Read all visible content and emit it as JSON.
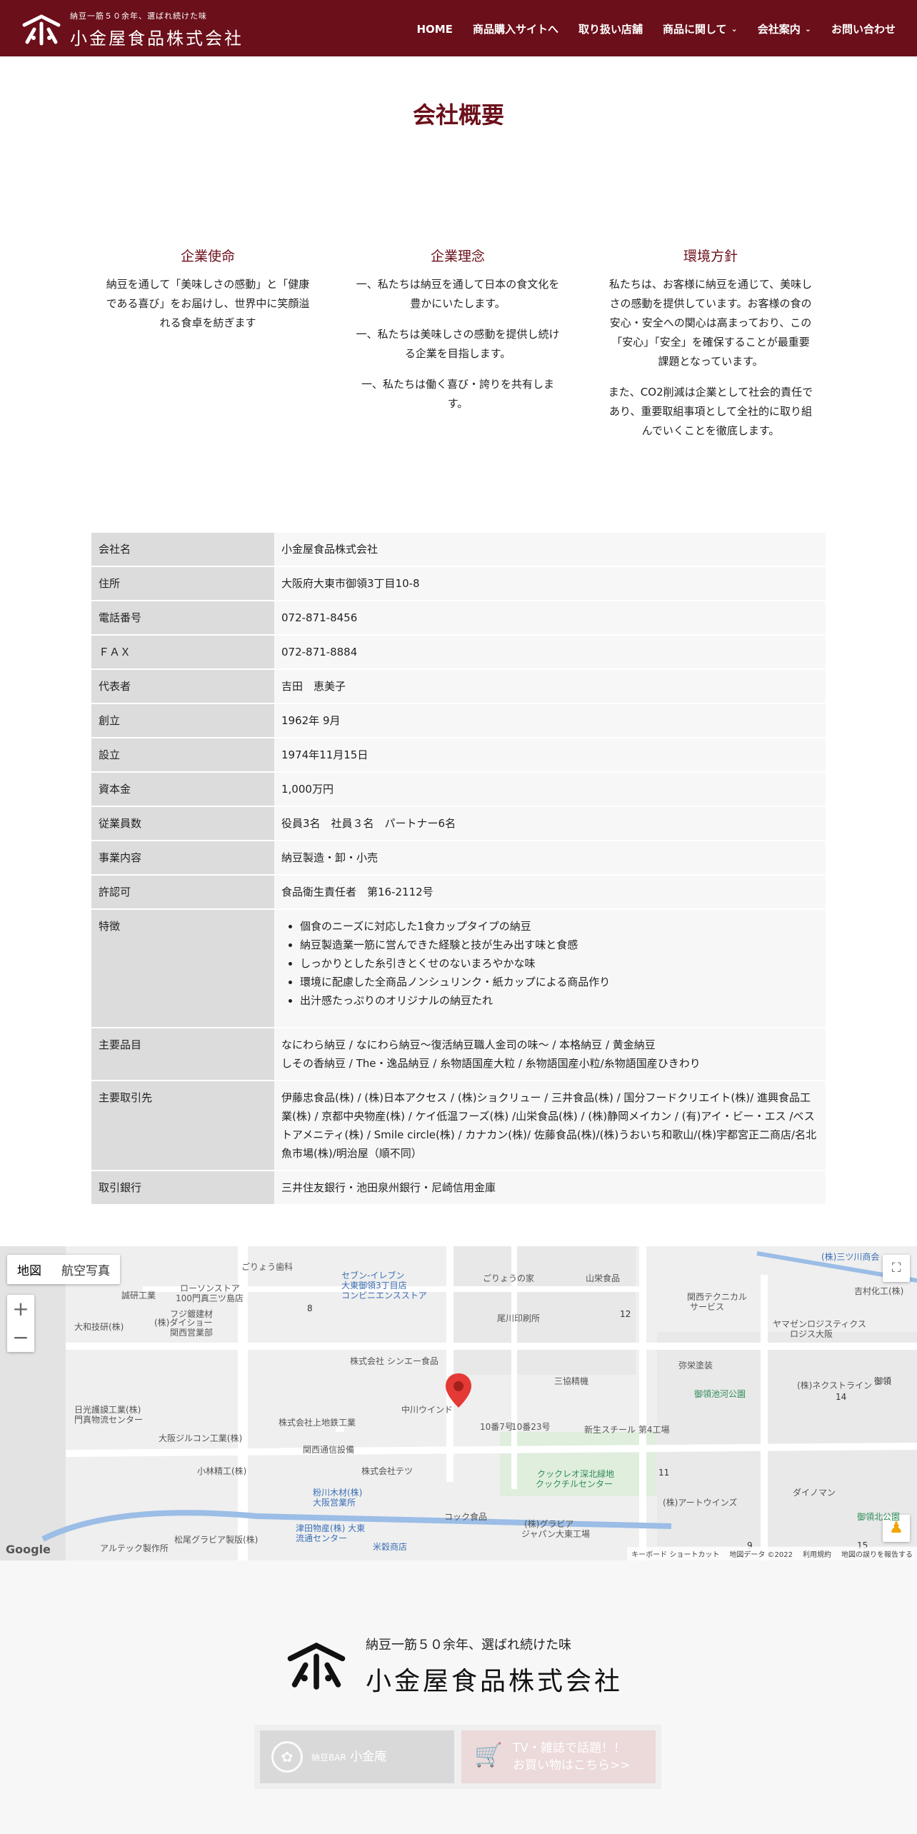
{
  "header": {
    "tagline": "納豆一筋５０余年、選ばれ続けた味",
    "company_name": "小金屋食品株式会社",
    "nav": [
      {
        "label": "HOME"
      },
      {
        "label": "商品購入サイトへ"
      },
      {
        "label": "取り扱い店舗"
      },
      {
        "label": "商品に関して"
      },
      {
        "label": "会社案内"
      },
      {
        "label": "お問い合わせ"
      }
    ]
  },
  "page": {
    "title": "会社概要"
  },
  "columns": [
    {
      "title": "企業使命",
      "paragraphs": [
        "納豆を通して「美味しさの感動」と「健康である喜び」をお届けし、世界中に笑顔溢れる食卓を紡ぎます"
      ]
    },
    {
      "title": "企業理念",
      "paragraphs": [
        "一、私たちは納豆を通して日本の食文化を豊かにいたします。",
        "一、私たちは美味しさの感動を提供し続ける企業を目指します。",
        "一、私たちは働く喜び・誇りを共有します。"
      ]
    },
    {
      "title": "環境方針",
      "paragraphs": [
        "私たちは、お客様に納豆を通じて、美味しさの感動を提供しています。お客様の食の安心・安全への関心は高まっており、この「安心」「安全」を確保することが最重要課題となっています。",
        "また、CO2削減は企業として社会的責任であり、重要取組事項として全社的に取り組んでいくことを徹底します。"
      ]
    }
  ],
  "table": {
    "rows": [
      {
        "key": "会社名",
        "value": "小金屋食品株式会社"
      },
      {
        "key": "住所",
        "value": "大阪府大東市御領3丁目10-8"
      },
      {
        "key": "電話番号",
        "value": "072-871-8456"
      },
      {
        "key": "ＦＡＸ",
        "value": "072-871-8884"
      },
      {
        "key": "代表者",
        "value": "吉田　恵美子"
      },
      {
        "key": "創立",
        "value": "1962年 9月"
      },
      {
        "key": "設立",
        "value": "1974年11月15日"
      },
      {
        "key": "資本金",
        "value": "1,000万円"
      },
      {
        "key": "従業員数",
        "value": "役員3名　社員３名　パートナー6名"
      },
      {
        "key": "事業内容",
        "value": "納豆製造・卸・小売"
      },
      {
        "key": "許認可",
        "value": "食品衛生責任者　第16-2112号"
      }
    ],
    "features": {
      "key": "特徴",
      "items": [
        "個食のニーズに対応した1食カップタイプの納豆",
        "納豆製造業一筋に営んできた経験と技が生み出す味と食感",
        "しっかりとした糸引きとくせのないまろやかな味",
        "環境に配慮した全商品ノンシュリンク・紙カップによる商品作り",
        "出汁感たっぷりのオリジナルの納豆たれ"
      ]
    },
    "products": {
      "key": "主要品目",
      "lines": [
        "なにわら納豆 / なにわら納豆～復活納豆職人金司の味～ / 本格納豆 / 黄金納豆",
        "しその香納豆 /  The・逸品納豆 / 糸物語国産大粒 / 糸物語国産小粒/糸物語国産ひきわり"
      ]
    },
    "partners": {
      "key": "主要取引先",
      "value": "伊藤忠食品(株) / (株)日本アクセス / (株)ショクリュー / 三井食品(株) / 国分フードクリエイト(株)/ 進興食品工業(株) / 京都中央物産(株) / ケイ低温フーズ(株) /山栄食品(株) / (株)静岡メイカン / (有)アイ・ビー・エス /ベストアメニティ(株) / Smile circle(株) / カナカン(株)/ 佐藤食品(株)/(株)うおいち和歌山/(株)宇都宮正二商店/名北魚市場(株)/明治屋（順不同）"
    },
    "bank": {
      "key": "取引銀行",
      "value": "三井住友銀行・池田泉州銀行・尼崎信用金庫"
    }
  },
  "map": {
    "tabs": [
      {
        "label": "地図"
      },
      {
        "label": "航空写真"
      }
    ],
    "zoom_in": "+",
    "zoom_out": "−",
    "google": "Google",
    "attribution": [
      "キーボード ショートカット",
      "地図データ ©2022",
      "利用規約",
      "地図の誤りを報告する"
    ],
    "labels": [
      {
        "text": "セブン-イレブン",
        "cls": "blue"
      },
      {
        "text": "大東御領3丁目店",
        "cls": "blue"
      },
      {
        "text": "コンビニエンスストア",
        "cls": "blue"
      },
      {
        "text": "ごりょうの家",
        "cls": ""
      },
      {
        "text": "山栄食品",
        "cls": ""
      },
      {
        "text": "(株)三ツ川商会",
        "cls": "blue"
      },
      {
        "text": "吉村化工(株)",
        "cls": ""
      },
      {
        "text": "関西テクニカル",
        "cls": ""
      },
      {
        "text": "サービス",
        "cls": ""
      },
      {
        "text": "尾川印刷所",
        "cls": ""
      },
      {
        "text": "ヤマゼンロジスティクス",
        "cls": ""
      },
      {
        "text": "ロジス大阪",
        "cls": ""
      },
      {
        "text": "ローソンストア",
        "cls": ""
      },
      {
        "text": "100門真三ツ島店",
        "cls": ""
      },
      {
        "text": "ごりょう歯科",
        "cls": ""
      },
      {
        "text": "誠研工業",
        "cls": ""
      },
      {
        "text": "フジ鍍建材",
        "cls": ""
      },
      {
        "text": "大和技研(株)",
        "cls": ""
      },
      {
        "text": "(株)ダイショー",
        "cls": ""
      },
      {
        "text": "関西営業部",
        "cls": ""
      },
      {
        "text": "株式会社 シンエー食品",
        "cls": ""
      },
      {
        "text": "三協精機",
        "cls": ""
      },
      {
        "text": "弥栄塗装",
        "cls": ""
      },
      {
        "text": "御領池河公園",
        "cls": "green"
      },
      {
        "text": "(株)ネクストライン",
        "cls": ""
      },
      {
        "text": "日光護謨工業(株)",
        "cls": ""
      },
      {
        "text": "門真物流センター",
        "cls": ""
      },
      {
        "text": "株式会社上地鉄工業",
        "cls": ""
      },
      {
        "text": "中川ウインド",
        "cls": ""
      },
      {
        "text": "10番7号",
        "cls": ""
      },
      {
        "text": "10番23号",
        "cls": ""
      },
      {
        "text": "新生スチール 第4工場",
        "cls": ""
      },
      {
        "text": "大阪ジルコン工業(株)",
        "cls": ""
      },
      {
        "text": "関西通信設備",
        "cls": ""
      },
      {
        "text": "小林精工(株)",
        "cls": ""
      },
      {
        "text": "株式会社テツ",
        "cls": ""
      },
      {
        "text": "クックレオ深北緑地",
        "cls": "green"
      },
      {
        "text": "クックチルセンター",
        "cls": "green"
      },
      {
        "text": "(株)アートウインズ",
        "cls": ""
      },
      {
        "text": "ダイノマン",
        "cls": ""
      },
      {
        "text": "粉川木材(株)",
        "cls": "blue"
      },
      {
        "text": "大阪営業所",
        "cls": "blue"
      },
      {
        "text": "コック食品",
        "cls": ""
      },
      {
        "text": "津田物産(株) 大東",
        "cls": "blue"
      },
      {
        "text": "流通センター",
        "cls": "blue"
      },
      {
        "text": "米穀商店",
        "cls": "blue"
      },
      {
        "text": "(株)グラビア",
        "cls": ""
      },
      {
        "text": "ジャパン大東工場",
        "cls": ""
      },
      {
        "text": "アルテック製作所",
        "cls": ""
      },
      {
        "text": "松尾グラビア製版(株)",
        "cls": ""
      },
      {
        "text": "御領北公園",
        "cls": "green"
      },
      {
        "text": "8",
        "cls": "street"
      },
      {
        "text": "12",
        "cls": "street"
      },
      {
        "text": "14",
        "cls": "street"
      },
      {
        "text": "11",
        "cls": "street"
      },
      {
        "text": "15",
        "cls": "street"
      },
      {
        "text": "9",
        "cls": "street"
      },
      {
        "text": "御領",
        "cls": "street"
      }
    ]
  },
  "footer": {
    "tagline": "納豆一筋５０余年、選ばれ続けた味",
    "company_name": "小金屋食品株式会社",
    "banner1": {
      "small": "納豆BAR",
      "big": "小金庵"
    },
    "banner2": {
      "line1": "TV・雑誌で話題！！",
      "line2": "お買い物はこちら>>"
    }
  },
  "colors": {
    "brand": "#6b0f1a",
    "table_key_bg": "#dcdcdc",
    "table_value_bg": "#f7f7f7"
  }
}
